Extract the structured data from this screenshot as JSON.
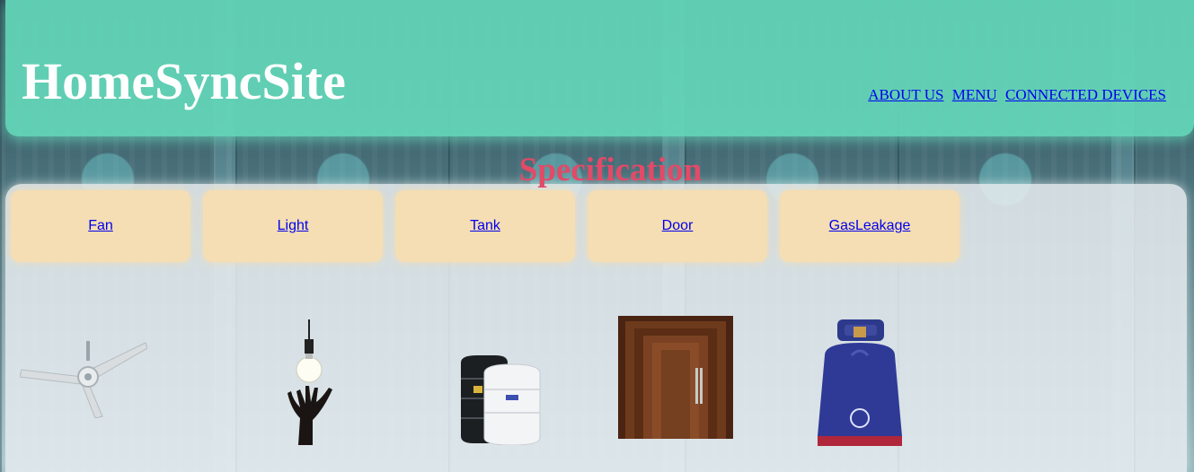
{
  "header": {
    "site_title": "HomeSyncSite",
    "nav": [
      "ABOUT US",
      "MENU",
      "CONNECTED DEVICES"
    ]
  },
  "main": {
    "section_title": "Specification",
    "devices": [
      {
        "label": "Fan",
        "image": "ceiling-fan-image"
      },
      {
        "label": "Light",
        "image": "light-bulb-image"
      },
      {
        "label": "Tank",
        "image": "water-tank-image"
      },
      {
        "label": "Door",
        "image": "wooden-door-image"
      },
      {
        "label": "GasLeakage",
        "image": "gas-cylinder-image"
      }
    ]
  },
  "colors": {
    "header_bg": "#64d7b9",
    "title_text": "#ffffff",
    "section_title": "#e24a68",
    "card_bg": "#f5deb3",
    "link": "#0000ee"
  }
}
